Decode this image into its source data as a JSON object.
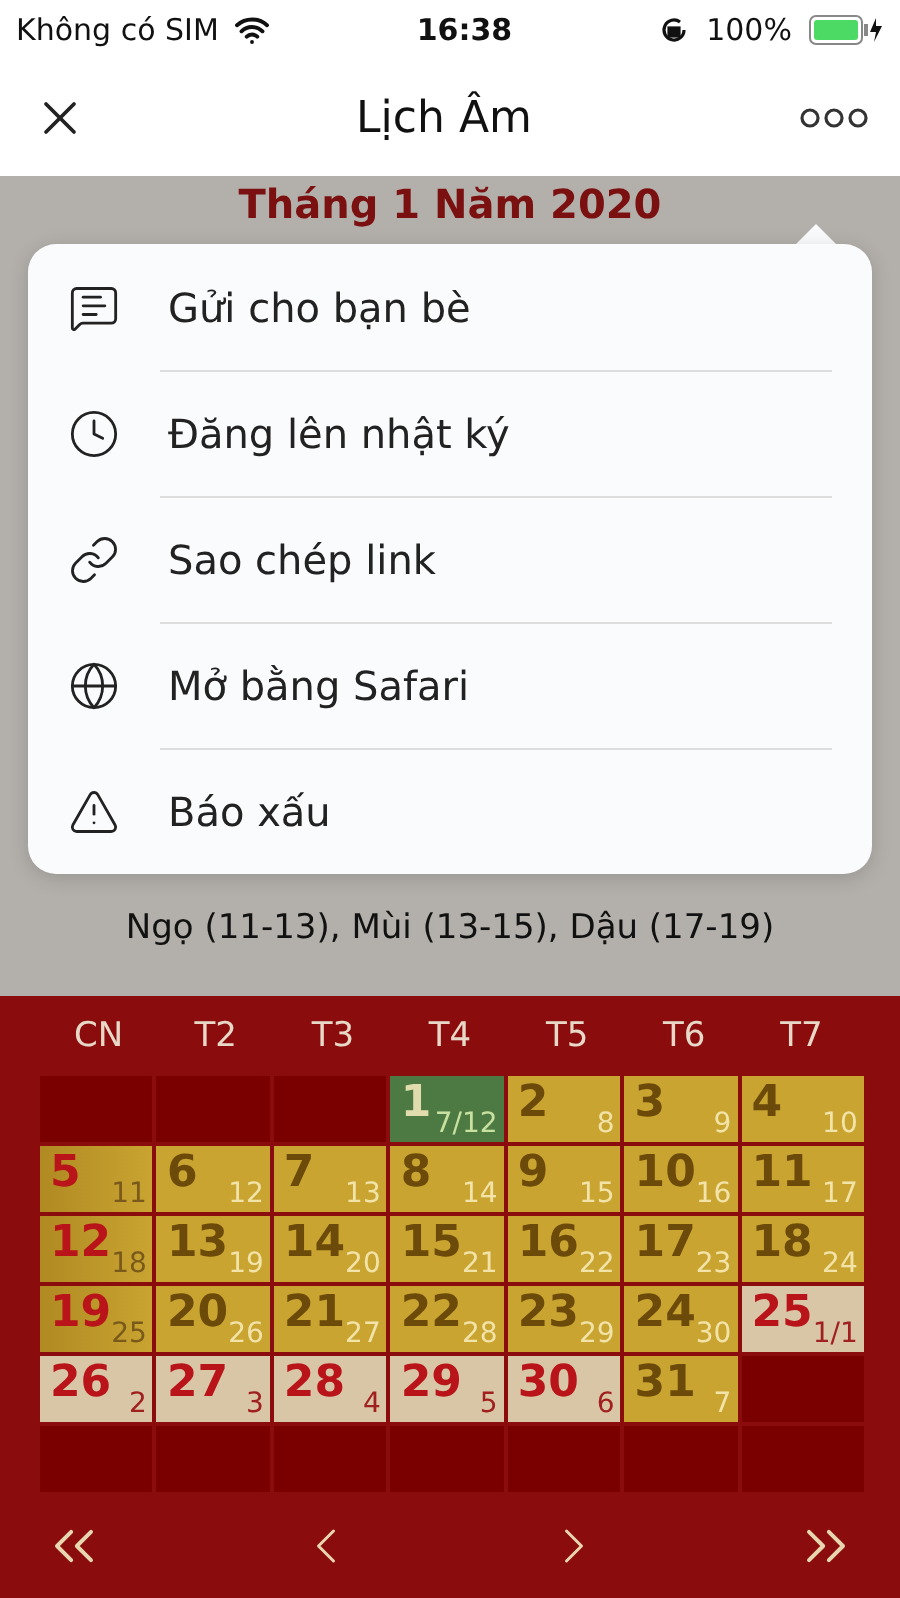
{
  "status_bar": {
    "carrier": "Không có SIM",
    "time": "16:38",
    "battery": "100%"
  },
  "nav": {
    "title": "Lịch Âm"
  },
  "page": {
    "month_title": "Tháng 1 Năm 2020",
    "hours_line": "Ngọ (11-13), Mùi (13-15), Dậu (17-19)"
  },
  "menu": {
    "items": [
      {
        "label": "Gửi cho bạn bè",
        "kind": "message"
      },
      {
        "label": "Đăng lên nhật ký",
        "kind": "clock"
      },
      {
        "label": "Sao chép link",
        "kind": "link"
      },
      {
        "label": "Mở bằng Safari",
        "kind": "globe"
      },
      {
        "label": "Báo xấu",
        "kind": "warning"
      }
    ]
  },
  "calendar": {
    "weekdays": [
      "CN",
      "T2",
      "T3",
      "T4",
      "T5",
      "T6",
      "T7"
    ],
    "weeks": [
      [
        {
          "kind": "empty"
        },
        {
          "kind": "empty"
        },
        {
          "kind": "empty"
        },
        {
          "day": "1",
          "lunar": "7/12",
          "kind": "today"
        },
        {
          "day": "2",
          "lunar": "8",
          "kind": "normal"
        },
        {
          "day": "3",
          "lunar": "9",
          "kind": "normal"
        },
        {
          "day": "4",
          "lunar": "10",
          "kind": "normal"
        }
      ],
      [
        {
          "day": "5",
          "lunar": "11",
          "kind": "sunday"
        },
        {
          "day": "6",
          "lunar": "12",
          "kind": "normal"
        },
        {
          "day": "7",
          "lunar": "13",
          "kind": "normal"
        },
        {
          "day": "8",
          "lunar": "14",
          "kind": "normal"
        },
        {
          "day": "9",
          "lunar": "15",
          "kind": "normal"
        },
        {
          "day": "10",
          "lunar": "16",
          "kind": "normal"
        },
        {
          "day": "11",
          "lunar": "17",
          "kind": "normal"
        }
      ],
      [
        {
          "day": "12",
          "lunar": "18",
          "kind": "sunday"
        },
        {
          "day": "13",
          "lunar": "19",
          "kind": "normal"
        },
        {
          "day": "14",
          "lunar": "20",
          "kind": "normal"
        },
        {
          "day": "15",
          "lunar": "21",
          "kind": "normal"
        },
        {
          "day": "16",
          "lunar": "22",
          "kind": "normal"
        },
        {
          "day": "17",
          "lunar": "23",
          "kind": "normal"
        },
        {
          "day": "18",
          "lunar": "24",
          "kind": "normal"
        }
      ],
      [
        {
          "day": "19",
          "lunar": "25",
          "kind": "sunday"
        },
        {
          "day": "20",
          "lunar": "26",
          "kind": "normal"
        },
        {
          "day": "21",
          "lunar": "27",
          "kind": "normal"
        },
        {
          "day": "22",
          "lunar": "28",
          "kind": "normal"
        },
        {
          "day": "23",
          "lunar": "29",
          "kind": "normal"
        },
        {
          "day": "24",
          "lunar": "30",
          "kind": "normal"
        },
        {
          "day": "25",
          "lunar": "1/1",
          "kind": "holiday"
        }
      ],
      [
        {
          "day": "26",
          "lunar": "2",
          "kind": "holiday"
        },
        {
          "day": "27",
          "lunar": "3",
          "kind": "holiday"
        },
        {
          "day": "28",
          "lunar": "4",
          "kind": "holiday"
        },
        {
          "day": "29",
          "lunar": "5",
          "kind": "holiday"
        },
        {
          "day": "30",
          "lunar": "6",
          "kind": "holiday"
        },
        {
          "day": "31",
          "lunar": "7",
          "kind": "normal"
        },
        {
          "kind": "empty"
        }
      ],
      [
        {
          "kind": "empty"
        },
        {
          "kind": "empty"
        },
        {
          "kind": "empty"
        },
        {
          "kind": "empty"
        },
        {
          "kind": "empty"
        },
        {
          "kind": "empty"
        },
        {
          "kind": "empty"
        }
      ]
    ]
  }
}
